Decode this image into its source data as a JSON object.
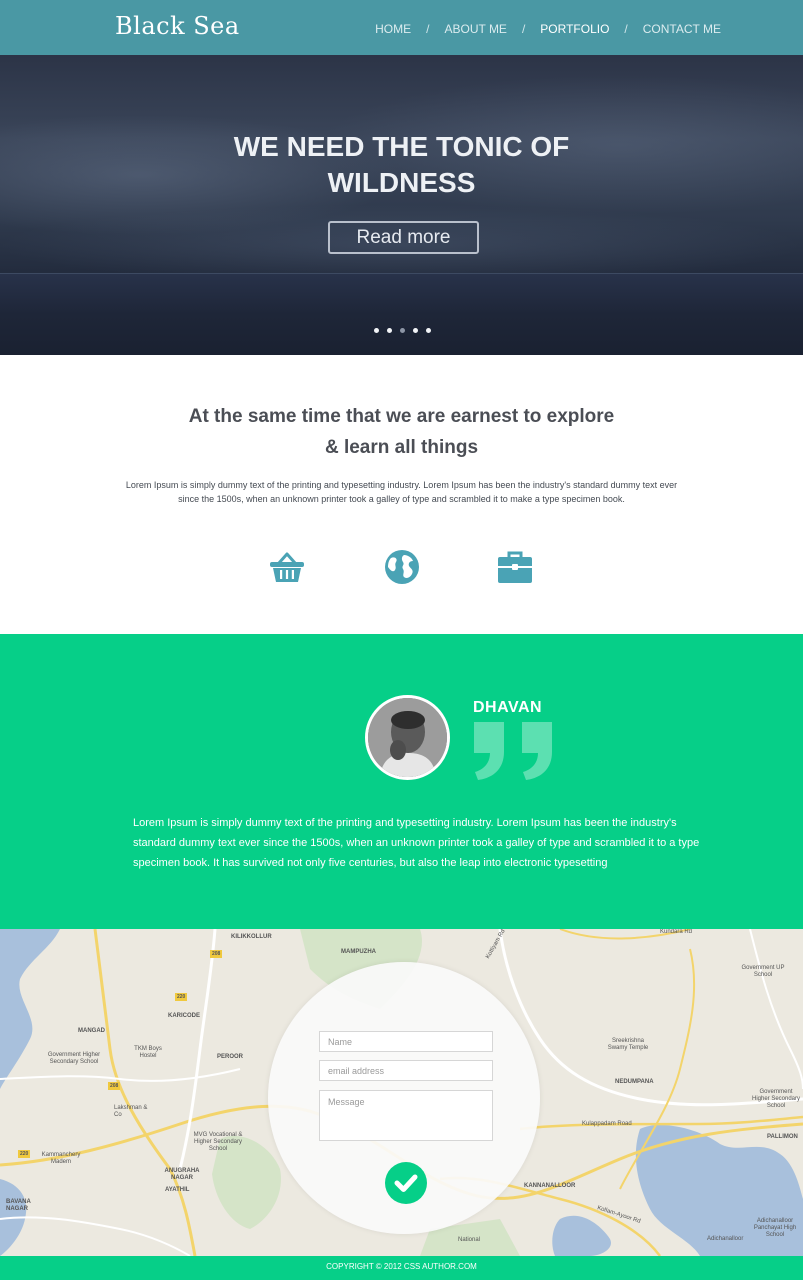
{
  "header": {
    "logo": "Black Sea",
    "nav": [
      "HOME",
      "ABOUT ME",
      "PORTFOLIO",
      "CONTACT ME"
    ],
    "nav_separator": "/",
    "active_nav": "PORTFOLIO"
  },
  "hero": {
    "title_line1": "WE NEED THE TONIC OF",
    "title_line2": "WILDNESS",
    "button_label": "Read more",
    "slide_count": 5,
    "active_slide": 3
  },
  "intro": {
    "heading_line1": "At the same time that we are earnest to explore",
    "heading_line2": "& learn all things",
    "body": "Lorem Ipsum is simply dummy text of the printing and typesetting industry. Lorem Ipsum has been the industry's standard dummy text ever since the 1500s, when an unknown printer took a galley of type and scrambled it to make a type specimen book.",
    "icons": [
      "basket-icon",
      "globe-icon",
      "briefcase-icon"
    ],
    "icon_color": "#4aa3b5"
  },
  "testimonial": {
    "name": "DHAVAN",
    "text": "Lorem Ipsum is simply dummy text of the printing and typesetting industry. Lorem Ipsum has been the industry's standard dummy text ever since the 1500s, when an unknown printer took a galley of type and scrambled it to a type specimen book. It has survived not only five centuries, but also the leap into electronic typesetting",
    "background_color": "#06cf88"
  },
  "map": {
    "labels": [
      "KILIKKOLLUR",
      "MAMPUZHA",
      "Kundara Rd",
      "Government UP School",
      "MANGAD",
      "KARICODE",
      "Government Higher Secondary School",
      "TKM Boys Hostel",
      "PEROOR",
      "Sreekrishna Swamy Temple",
      "NEDUMPANA",
      "Government Higher Secondary School",
      "Lakshman & Co",
      "Kulappadam Road",
      "PALLIMON",
      "MVG Vocational & Higher Secondary School",
      "Kammanchery Madem",
      "ANUGRAHA NAGAR",
      "AYATHIL",
      "KANNANALLOOR",
      "Adichanalloor Panchayat High School",
      "BAVANA NAGAR",
      "Kollam-Ayoor Rd",
      "National",
      "Adichanalloor",
      "Kottiyam Rd"
    ],
    "road_numbers": [
      "208",
      "220",
      "208",
      "220"
    ]
  },
  "contact_form": {
    "name_placeholder": "Name",
    "email_placeholder": "email address",
    "message_placeholder": "Message"
  },
  "footer": {
    "copyright": "COPYRIGHT © 2012 CSS AUTHOR.COM"
  }
}
